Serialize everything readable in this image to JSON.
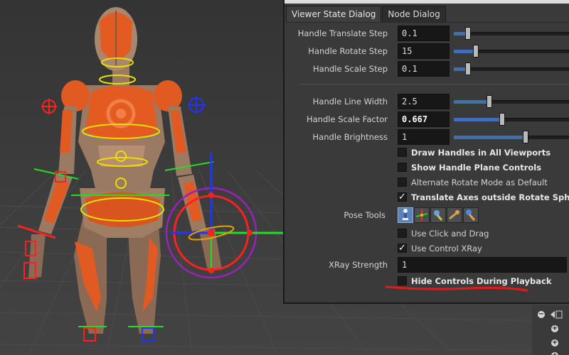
{
  "tabs": [
    {
      "label": "Viewer State Dialog",
      "active": true
    },
    {
      "label": "Node Dialog",
      "active": false
    }
  ],
  "params": {
    "translate_step": {
      "label": "Handle Translate Step",
      "value": "0.1",
      "fraction": 0.12
    },
    "rotate_step": {
      "label": "Handle Rotate Step",
      "value": "15",
      "fraction": 0.19
    },
    "scale_step": {
      "label": "Handle Scale Step",
      "value": "0.1",
      "fraction": 0.12
    },
    "line_width": {
      "label": "Handle Line Width",
      "value": "2.5",
      "fraction": 0.3
    },
    "scale_factor": {
      "label": "Handle Scale Factor",
      "value": "0.667",
      "fraction": 0.41
    },
    "brightness": {
      "label": "Handle Brightness",
      "value": "1",
      "fraction": 0.61
    }
  },
  "checkboxes": {
    "draw_all_viewports": {
      "label": "Draw Handles in All Viewports",
      "checked": false,
      "bold": true
    },
    "show_plane_controls": {
      "label": "Show Handle Plane Controls",
      "checked": false,
      "bold": true
    },
    "alt_rotate_mode": {
      "label": "Alternate Rotate Mode as Default",
      "checked": false,
      "bold": false
    },
    "translate_axes": {
      "label": "Translate Axes outside Rotate Sphere",
      "checked": true,
      "bold": true
    },
    "click_and_drag": {
      "label": "Use Click and Drag",
      "checked": false,
      "bold": false
    },
    "control_xray": {
      "label": "Use Control XRay",
      "checked": true,
      "bold": false
    },
    "hide_during_playback": {
      "label": "Hide Controls During Playback",
      "checked": false,
      "bold": true
    }
  },
  "pose_tools": {
    "label": "Pose Tools",
    "icons": [
      "pose-select-icon",
      "pose-translate-icon",
      "pose-rotate-icon",
      "pose-scale-icon",
      "pose-ik-icon"
    ],
    "selected_index": 0
  },
  "xray": {
    "label": "XRay Strength",
    "value": "1"
  },
  "colors": {
    "accent": "#3f6fb1",
    "figure_orange": "#e8581e",
    "figure_tan": "#9b7a60",
    "handle_red": "#ff2020",
    "handle_green": "#22dd22",
    "handle_blue": "#2233ff",
    "handle_yellow": "#e8e000",
    "handle_purple": "#9a22b8",
    "annotation_red": "#e81818"
  }
}
